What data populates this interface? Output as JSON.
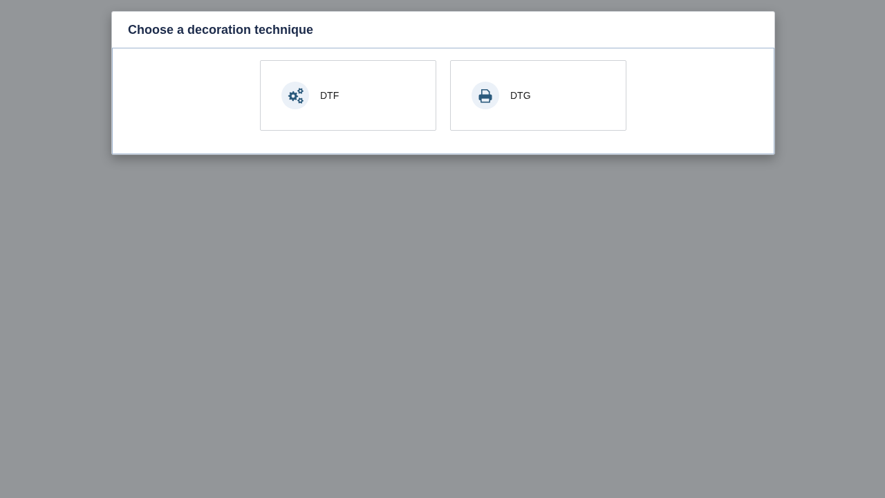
{
  "dialog": {
    "title": "Choose a decoration technique",
    "options": [
      {
        "kind": "gears",
        "label": "DTF"
      },
      {
        "kind": "printer",
        "label": "DTG"
      }
    ]
  }
}
